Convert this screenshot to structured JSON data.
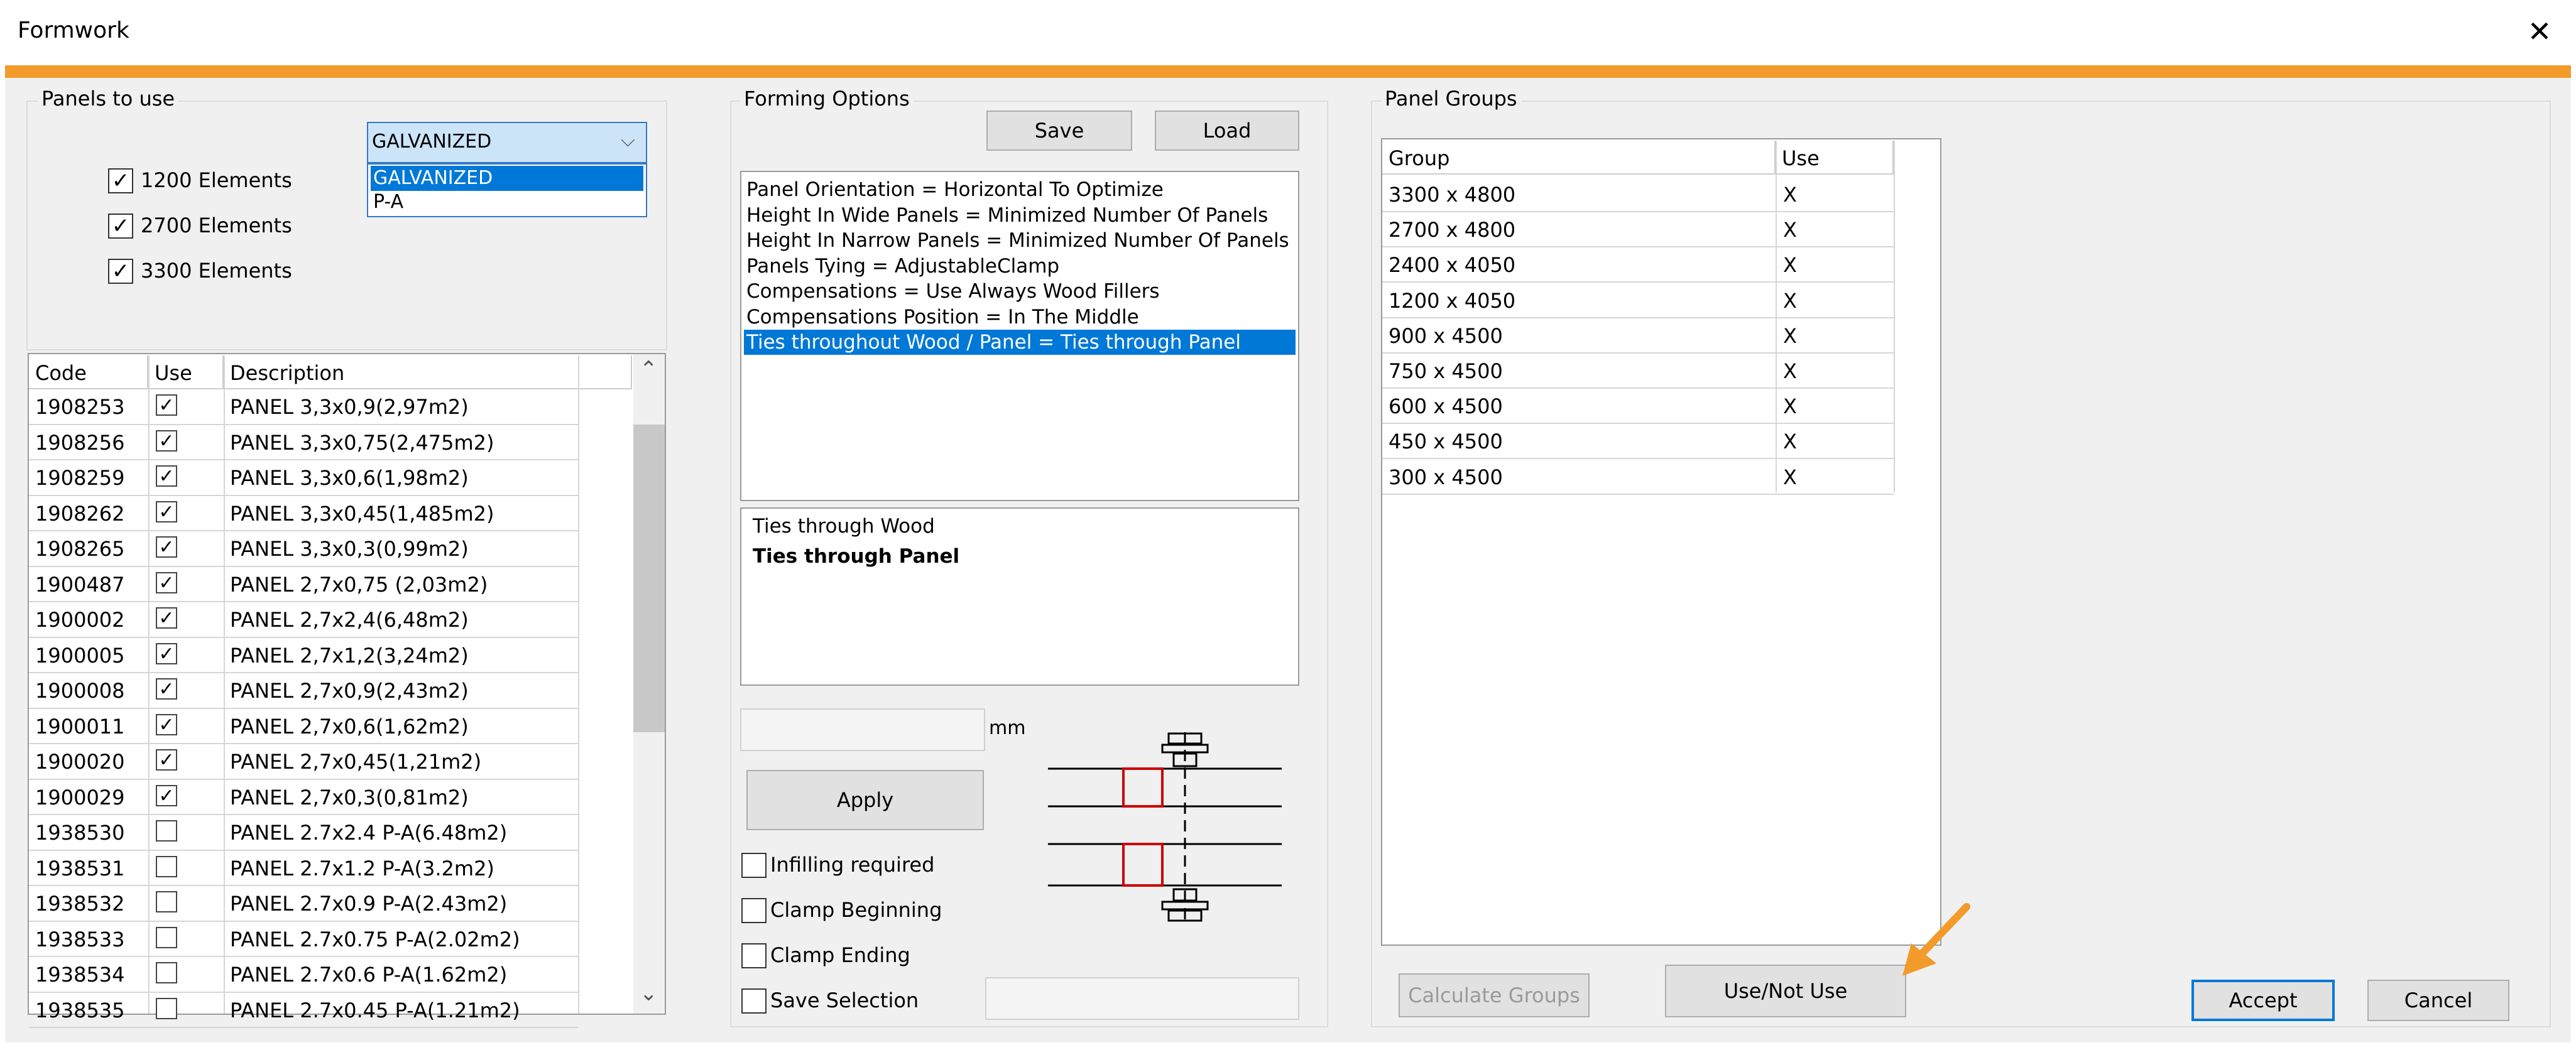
{
  "window": {
    "title": "Formwork",
    "close_glyph": "✕"
  },
  "colors": {
    "accent": "#f29b2b",
    "selection": "#0078d7",
    "arrow": "#f29b2b"
  },
  "panels_to_use": {
    "label": "Panels to use",
    "combo": {
      "value": "GALVANIZED",
      "options": [
        "GALVANIZED",
        "P-A"
      ]
    },
    "checkboxes": [
      {
        "label": "1200 Elements",
        "checked": true
      },
      {
        "label": "2700 Elements",
        "checked": true
      },
      {
        "label": "3300 Elements",
        "checked": true
      }
    ],
    "table": {
      "headers": [
        "Code",
        "Use",
        "Description"
      ],
      "rows": [
        {
          "code": "1908253",
          "use": true,
          "desc": "PANEL 3,3x0,9(2,97m2)"
        },
        {
          "code": "1908256",
          "use": true,
          "desc": "PANEL 3,3x0,75(2,475m2)"
        },
        {
          "code": "1908259",
          "use": true,
          "desc": "PANEL 3,3x0,6(1,98m2)"
        },
        {
          "code": "1908262",
          "use": true,
          "desc": "PANEL 3,3x0,45(1,485m2)"
        },
        {
          "code": "1908265",
          "use": true,
          "desc": "PANEL 3,3x0,3(0,99m2)"
        },
        {
          "code": "1900487",
          "use": true,
          "desc": "PANEL 2,7x0,75 (2,03m2)"
        },
        {
          "code": "1900002",
          "use": true,
          "desc": "PANEL 2,7x2,4(6,48m2)"
        },
        {
          "code": "1900005",
          "use": true,
          "desc": "PANEL 2,7x1,2(3,24m2)"
        },
        {
          "code": "1900008",
          "use": true,
          "desc": "PANEL 2,7x0,9(2,43m2)"
        },
        {
          "code": "1900011",
          "use": true,
          "desc": "PANEL 2,7x0,6(1,62m2)"
        },
        {
          "code": "1900020",
          "use": true,
          "desc": "PANEL 2,7x0,45(1,21m2)"
        },
        {
          "code": "1900029",
          "use": true,
          "desc": "PANEL 2,7x0,3(0,81m2)"
        },
        {
          "code": "1938530",
          "use": false,
          "desc": "PANEL 2.7x2.4 P-A(6.48m2)"
        },
        {
          "code": "1938531",
          "use": false,
          "desc": "PANEL 2.7x1.2 P-A(3.2m2)"
        },
        {
          "code": "1938532",
          "use": false,
          "desc": "PANEL 2.7x0.9 P-A(2.43m2)"
        },
        {
          "code": "1938533",
          "use": false,
          "desc": "PANEL 2.7x0.75 P-A(2.02m2)"
        },
        {
          "code": "1938534",
          "use": false,
          "desc": "PANEL 2.7x0.6 P-A(1.62m2)"
        },
        {
          "code": "1938535",
          "use": false,
          "desc": "PANEL 2.7x0.45 P-A(1.21m2)"
        }
      ]
    }
  },
  "forming_options": {
    "label": "Forming Options",
    "save_label": "Save",
    "load_label": "Load",
    "options": [
      "Panel Orientation = Horizontal To Optimize",
      "Height In Wide Panels = Minimized Number Of Panels",
      "Height In Narrow Panels = Minimized Number Of Panels",
      "Panels Tying = AdjustableClamp",
      "Compensations = Use Always Wood Fillers",
      "Compensations Position = In The Middle",
      "Ties throughout Wood / Panel = Ties through Panel"
    ],
    "selected_index": 6,
    "values": [
      "Ties through Wood",
      "Ties through Panel"
    ],
    "value_selected_index": 1,
    "mm_value": "",
    "mm_unit": "mm",
    "apply_label": "Apply",
    "checkboxes": [
      {
        "label": "Infilling required",
        "checked": false
      },
      {
        "label": "Clamp Beginning",
        "checked": false
      },
      {
        "label": "Clamp Ending",
        "checked": false
      },
      {
        "label": "Save Selection",
        "checked": false
      }
    ],
    "save_selection_value": ""
  },
  "panel_groups": {
    "label": "Panel Groups",
    "headers": [
      "Group",
      "Use"
    ],
    "rows": [
      {
        "group": "3300 x 4800",
        "use": "X"
      },
      {
        "group": "2700 x 4800",
        "use": "X"
      },
      {
        "group": "2400 x 4050",
        "use": "X"
      },
      {
        "group": "1200 x 4050",
        "use": "X"
      },
      {
        "group": "900 x 4500",
        "use": "X"
      },
      {
        "group": "750 x 4500",
        "use": "X"
      },
      {
        "group": "600 x 4500",
        "use": "X"
      },
      {
        "group": "450 x 4500",
        "use": "X"
      },
      {
        "group": "300 x 4500",
        "use": "X"
      }
    ],
    "calculate_label": "Calculate Groups",
    "use_not_use_label": "Use/Not Use"
  },
  "footer": {
    "accept_label": "Accept",
    "cancel_label": "Cancel"
  },
  "glyphs": {
    "check": "✓",
    "dropdown": "⌵",
    "scroll_up": "⌃",
    "scroll_down": "⌄"
  }
}
